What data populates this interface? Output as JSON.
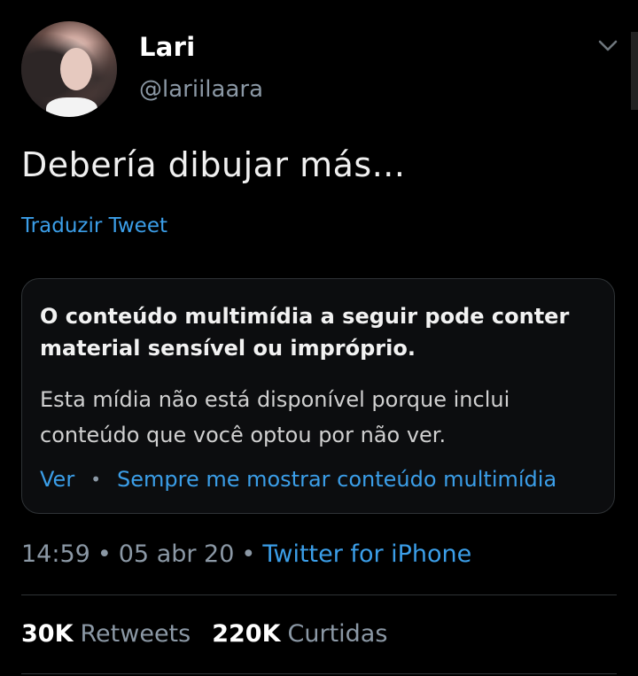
{
  "user": {
    "display_name": "Lari",
    "handle": "@lariilaara"
  },
  "tweet": {
    "text": "Debería dibujar más...",
    "translate_label": "Traduzir Tweet"
  },
  "media_warning": {
    "title": "O conteúdo multimídia a seguir pode conter material sensível ou impróprio.",
    "body": "Esta mídia não está disponível porque inclui conteúdo que você optou por não ver.",
    "view_label": "Ver",
    "separator": "•",
    "always_show_label": "Sempre me mostrar conteúdo multimídia"
  },
  "meta": {
    "time": "14:59",
    "dot": "•",
    "date": "05 abr 20",
    "source": "Twitter for iPhone"
  },
  "stats": {
    "retweets_count": "30K",
    "retweets_label": "Retweets",
    "likes_count": "220K",
    "likes_label": "Curtidas"
  },
  "icons": {
    "menu": "chevron-down-icon"
  },
  "colors": {
    "background": "#000000",
    "link": "#3b9ee8",
    "secondary_text": "#8b98a5",
    "border": "#2f3336"
  }
}
